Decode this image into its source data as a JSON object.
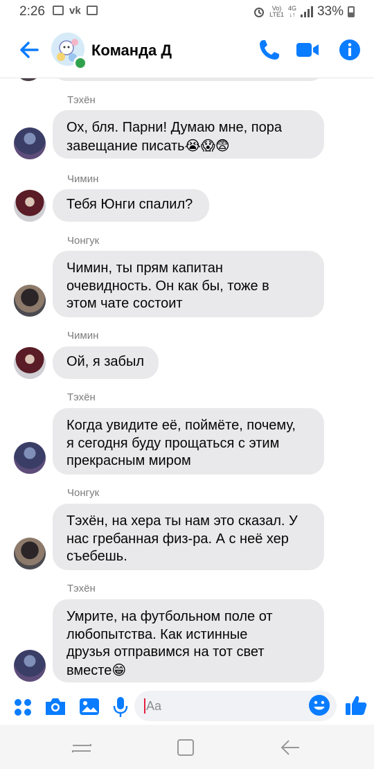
{
  "status_bar": {
    "time": "2:26",
    "battery": "33%",
    "network_tiny_1": "Vo)",
    "network_tiny_2": "LTE1",
    "network_tiny_3": "4G",
    "left_icons": [
      "gallery-icon",
      "vk-icon",
      "screenshot-icon"
    ],
    "vk_label": "vk"
  },
  "header": {
    "title": "Команда Д",
    "back_icon": "arrow-left-icon",
    "call_icon": "phone-icon",
    "video_icon": "video-camera-icon",
    "info_icon": "info-icon",
    "accent_color": "#0a7cff",
    "online_color": "#31a24c"
  },
  "messages": [
    {
      "sender": "Тэхён",
      "lines": [
        "Ох, бля. Парни! Думаю мне, пора",
        "завещание писать"
      ],
      "emoji": "😭😱😨"
    },
    {
      "sender": "Чимин",
      "lines": [
        "Тебя Юнги спалил?"
      ]
    },
    {
      "sender": "Чонгук",
      "lines": [
        "Чимин, ты прям капитан",
        "очевидность. Он как бы, тоже в",
        "этом чате состоит"
      ]
    },
    {
      "sender": "Чимин",
      "lines": [
        "Ой, я забыл"
      ]
    },
    {
      "sender": "Тэхён",
      "lines": [
        "Когда увидите её, поймёте, почему,",
        "я сегодня буду прощаться с этим",
        "прекрасным миром"
      ]
    },
    {
      "sender": "Чонгук",
      "lines": [
        "Тэхён, на хера ты нам это сказал. У",
        "нас гребанная физ-ра. А с неё хер",
        "съебешь."
      ]
    },
    {
      "sender": "Тэхён",
      "lines": [
        "Умрите, на футбольном поле от",
        "любопытства. Как истинные",
        "друзья отправимся на тот свет",
        "вместе"
      ],
      "emoji": "😁"
    }
  ],
  "composer": {
    "placeholder": "Aa",
    "icons": [
      "apps-icon",
      "camera-icon",
      "gallery-icon",
      "microphone-icon",
      "emoji-icon",
      "thumbs-up-icon"
    ]
  },
  "navbar": {
    "icons": [
      "recent-apps-icon",
      "home-icon",
      "back-icon"
    ]
  }
}
